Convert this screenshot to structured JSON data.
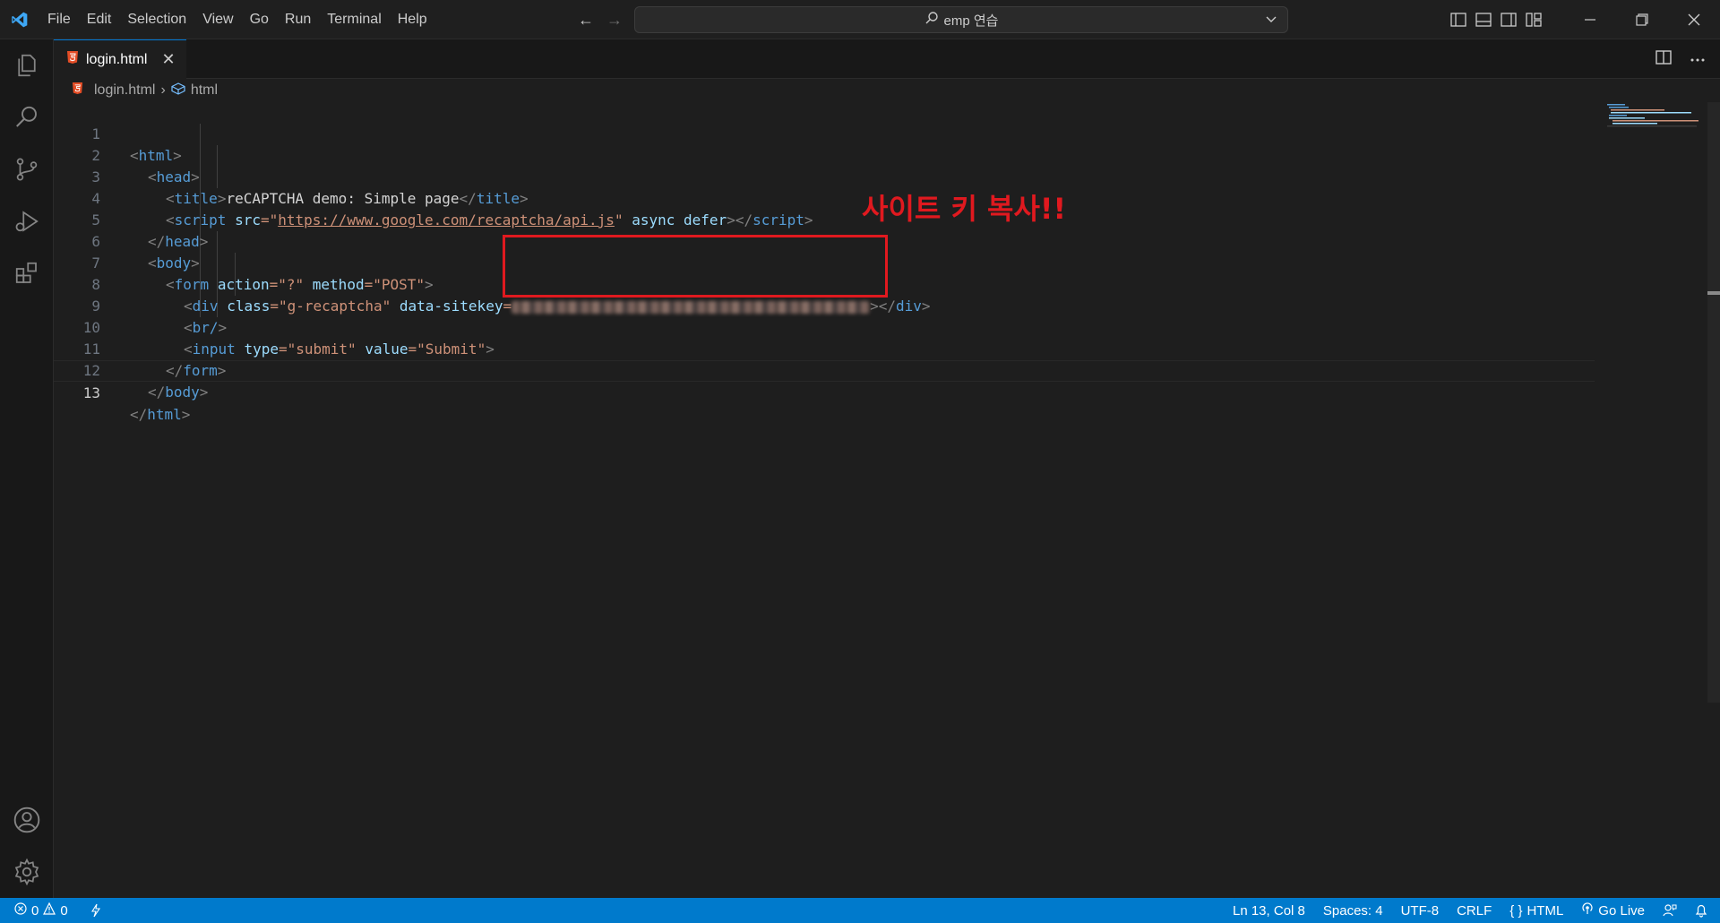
{
  "menu": [
    "File",
    "Edit",
    "Selection",
    "View",
    "Go",
    "Run",
    "Terminal",
    "Help"
  ],
  "command_center": {
    "text": "emp 연습"
  },
  "tab": {
    "label": "login.html",
    "close": "✕"
  },
  "breadcrumb": {
    "file": "login.html",
    "symbol": "html",
    "sep": "›"
  },
  "editor": {
    "active_line": 13,
    "line_numbers": [
      "1",
      "2",
      "3",
      "4",
      "5",
      "6",
      "7",
      "8",
      "9",
      "10",
      "11",
      "12",
      "13"
    ],
    "lines": [
      {
        "o": "<",
        "t": "html",
        "c": ">"
      },
      {
        "o": "<",
        "t": "head",
        "c": ">"
      },
      {
        "o": "<",
        "t": "title",
        "c": ">",
        "text": "reCAPTCHA demo: Simple page",
        "co": "</",
        "ct": "title",
        "cc": ">"
      },
      {
        "o": "<",
        "t": "script",
        "a1": "src",
        "eq": "=\"",
        "url": "https://www.google.com/recaptcha/api.js",
        "q": "\"",
        "a2": "async",
        "a3": "defer",
        "c": ">",
        "co": "</",
        "ct": "script",
        "cc": ">"
      },
      {
        "o": "</",
        "t": "head",
        "c": ">"
      },
      {
        "o": "<",
        "t": "body",
        "c": ">"
      },
      {
        "o": "<",
        "t": "form",
        "a1": "action",
        "v1": "=\"?\"",
        "a2": "method",
        "v2": "=\"POST\"",
        "c": ">"
      },
      {
        "o": "<",
        "t": "div",
        "a1": "class",
        "v1": "=\"g-recaptcha\"",
        "a2": "data-sitekey",
        "eq": "=",
        "c": ">",
        "co": "</",
        "ct": "div",
        "cc": ">"
      },
      {
        "o": "<",
        "t": "br/",
        "c": ">"
      },
      {
        "o": "<",
        "t": "input",
        "a1": "type",
        "v1": "=\"submit\"",
        "a2": "value",
        "v2": "=\"Submit\"",
        "c": ">"
      },
      {
        "o": "</",
        "t": "form",
        "c": ">"
      },
      {
        "o": "</",
        "t": "body",
        "c": ">"
      },
      {
        "o": "</",
        "t": "html",
        "c": ">"
      }
    ]
  },
  "annotation": {
    "text": "사이트 키 복사!!",
    "color": "#e0191f"
  },
  "status": {
    "errors": "0",
    "warnings": "0",
    "position": "Ln 13, Col 8",
    "spaces": "Spaces: 4",
    "encoding": "UTF-8",
    "eol": "CRLF",
    "language": "HTML",
    "golive": "Go Live"
  },
  "colors": {
    "accent": "#007acc",
    "tag": "#569cd6",
    "attr": "#9cdcfe",
    "string": "#ce9178"
  },
  "icons": [
    "vscode-logo-icon",
    "explorer-icon",
    "search-icon",
    "source-control-icon",
    "run-debug-icon",
    "extensions-icon",
    "account-icon",
    "gear-icon",
    "html5-file-icon",
    "split-editor-icon",
    "more-actions-icon"
  ]
}
